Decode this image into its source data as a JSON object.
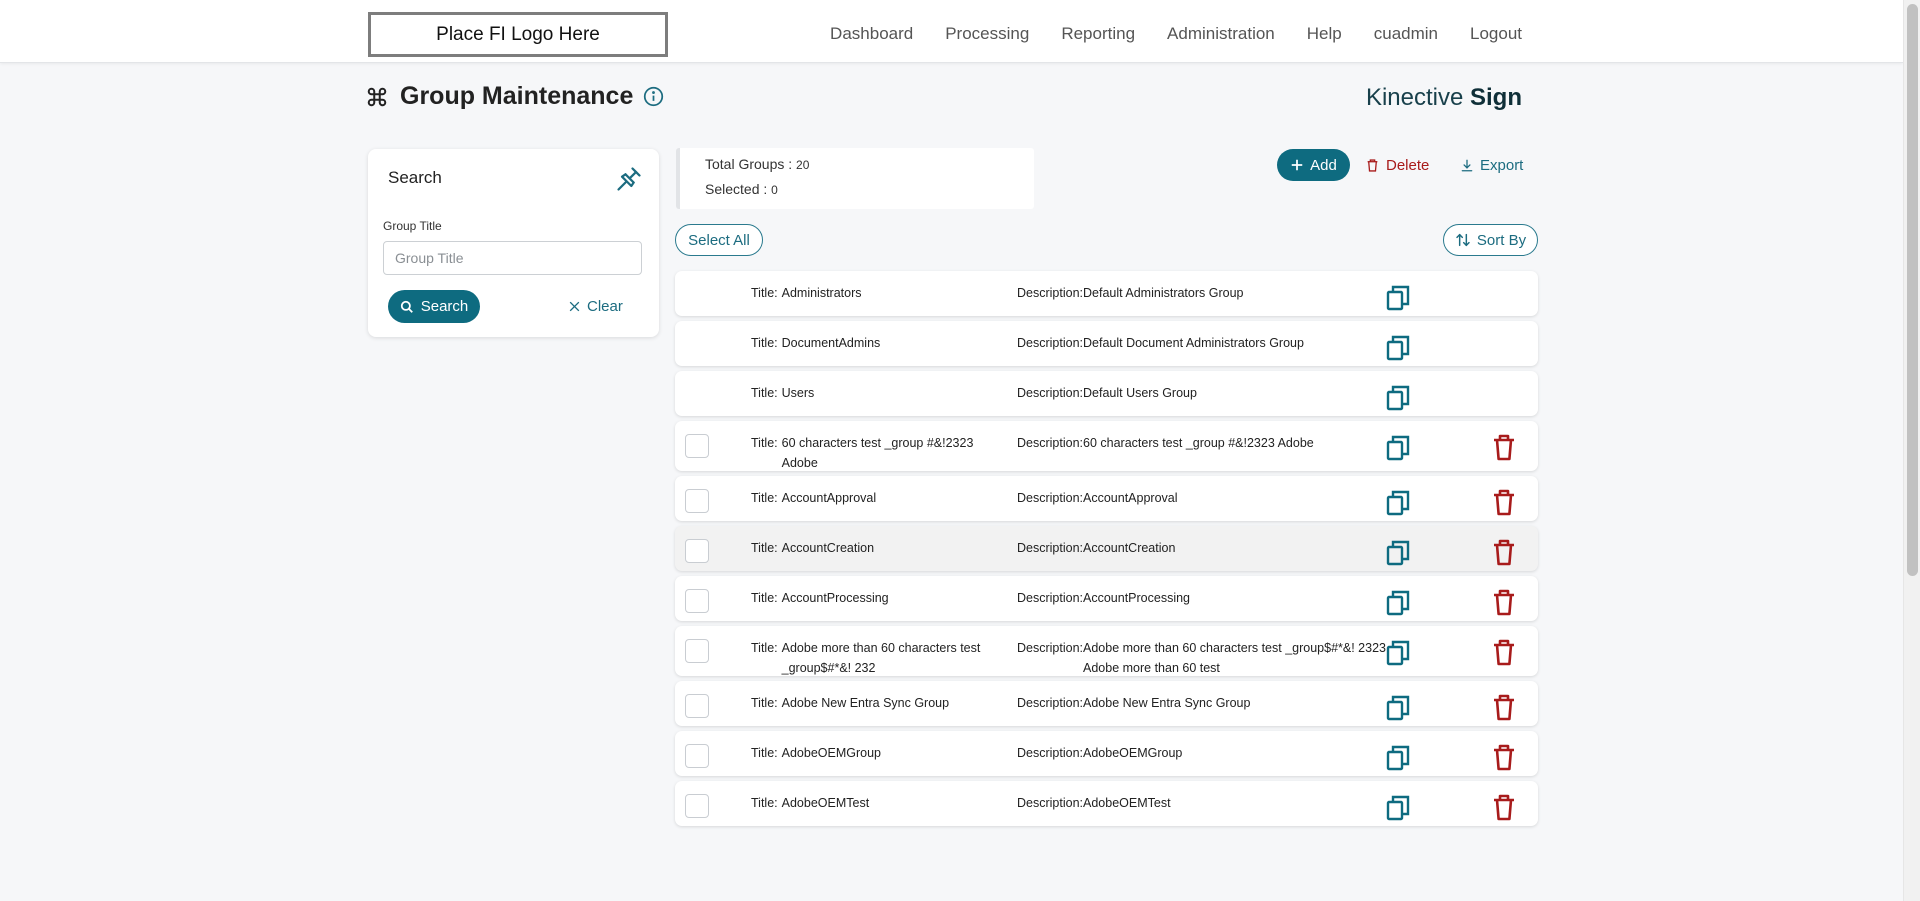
{
  "header": {
    "logo_text": "Place FI Logo Here",
    "nav": [
      "Dashboard",
      "Processing",
      "Reporting",
      "Administration",
      "Help",
      "cuadmin",
      "Logout"
    ]
  },
  "page": {
    "title": "Group Maintenance",
    "brand_light": "Kinective",
    "brand_bold": "Sign"
  },
  "search": {
    "title": "Search",
    "field_label": "Group Title",
    "field_placeholder": "Group Title",
    "field_value": "",
    "search_label": "Search",
    "clear_label": "Clear"
  },
  "summary": {
    "total_label": "Total Groups : ",
    "total_value": "20",
    "selected_label": "Selected : ",
    "selected_value": "0"
  },
  "actions": {
    "add_label": "Add",
    "delete_label": "Delete",
    "export_label": "Export",
    "select_all_label": "Select All",
    "sort_by_label": "Sort By"
  },
  "labels": {
    "title_prefix": "Title:",
    "desc_prefix": "Description:"
  },
  "colors": {
    "accent": "#0e6b80",
    "danger": "#a81b1b"
  },
  "groups": [
    {
      "title": "Administrators",
      "description": "Default Administrators Group",
      "selectable": false,
      "deletable": false,
      "highlighted": false,
      "two_line": false
    },
    {
      "title": "DocumentAdmins",
      "description": "Default Document Administrators Group",
      "selectable": false,
      "deletable": false,
      "highlighted": false,
      "two_line": false
    },
    {
      "title": "Users",
      "description": "Default Users Group",
      "selectable": false,
      "deletable": false,
      "highlighted": false,
      "two_line": false
    },
    {
      "title": "60 characters test _group #&!2323 Adobe",
      "description": "60 characters test _group #&!2323 Adobe",
      "selectable": true,
      "deletable": true,
      "highlighted": false,
      "two_line": true
    },
    {
      "title": "AccountApproval",
      "description": "AccountApproval",
      "selectable": true,
      "deletable": true,
      "highlighted": false,
      "two_line": false
    },
    {
      "title": "AccountCreation",
      "description": "AccountCreation",
      "selectable": true,
      "deletable": true,
      "highlighted": true,
      "two_line": false
    },
    {
      "title": "AccountProcessing",
      "description": "AccountProcessing",
      "selectable": true,
      "deletable": true,
      "highlighted": false,
      "two_line": false
    },
    {
      "title": "Adobe more than 60 characters test _group$#*&! 232",
      "description": "Adobe more than 60 characters test _group$#*&! 2323 Adobe more than 60 test",
      "selectable": true,
      "deletable": true,
      "highlighted": false,
      "two_line": true
    },
    {
      "title": "Adobe New Entra Sync Group",
      "description": "Adobe New Entra Sync Group",
      "selectable": true,
      "deletable": true,
      "highlighted": false,
      "two_line": false
    },
    {
      "title": "AdobeOEMGroup",
      "description": "AdobeOEMGroup",
      "selectable": true,
      "deletable": true,
      "highlighted": false,
      "two_line": false
    },
    {
      "title": "AdobeOEMTest",
      "description": "AdobeOEMTest",
      "selectable": true,
      "deletable": true,
      "highlighted": false,
      "two_line": false
    }
  ]
}
